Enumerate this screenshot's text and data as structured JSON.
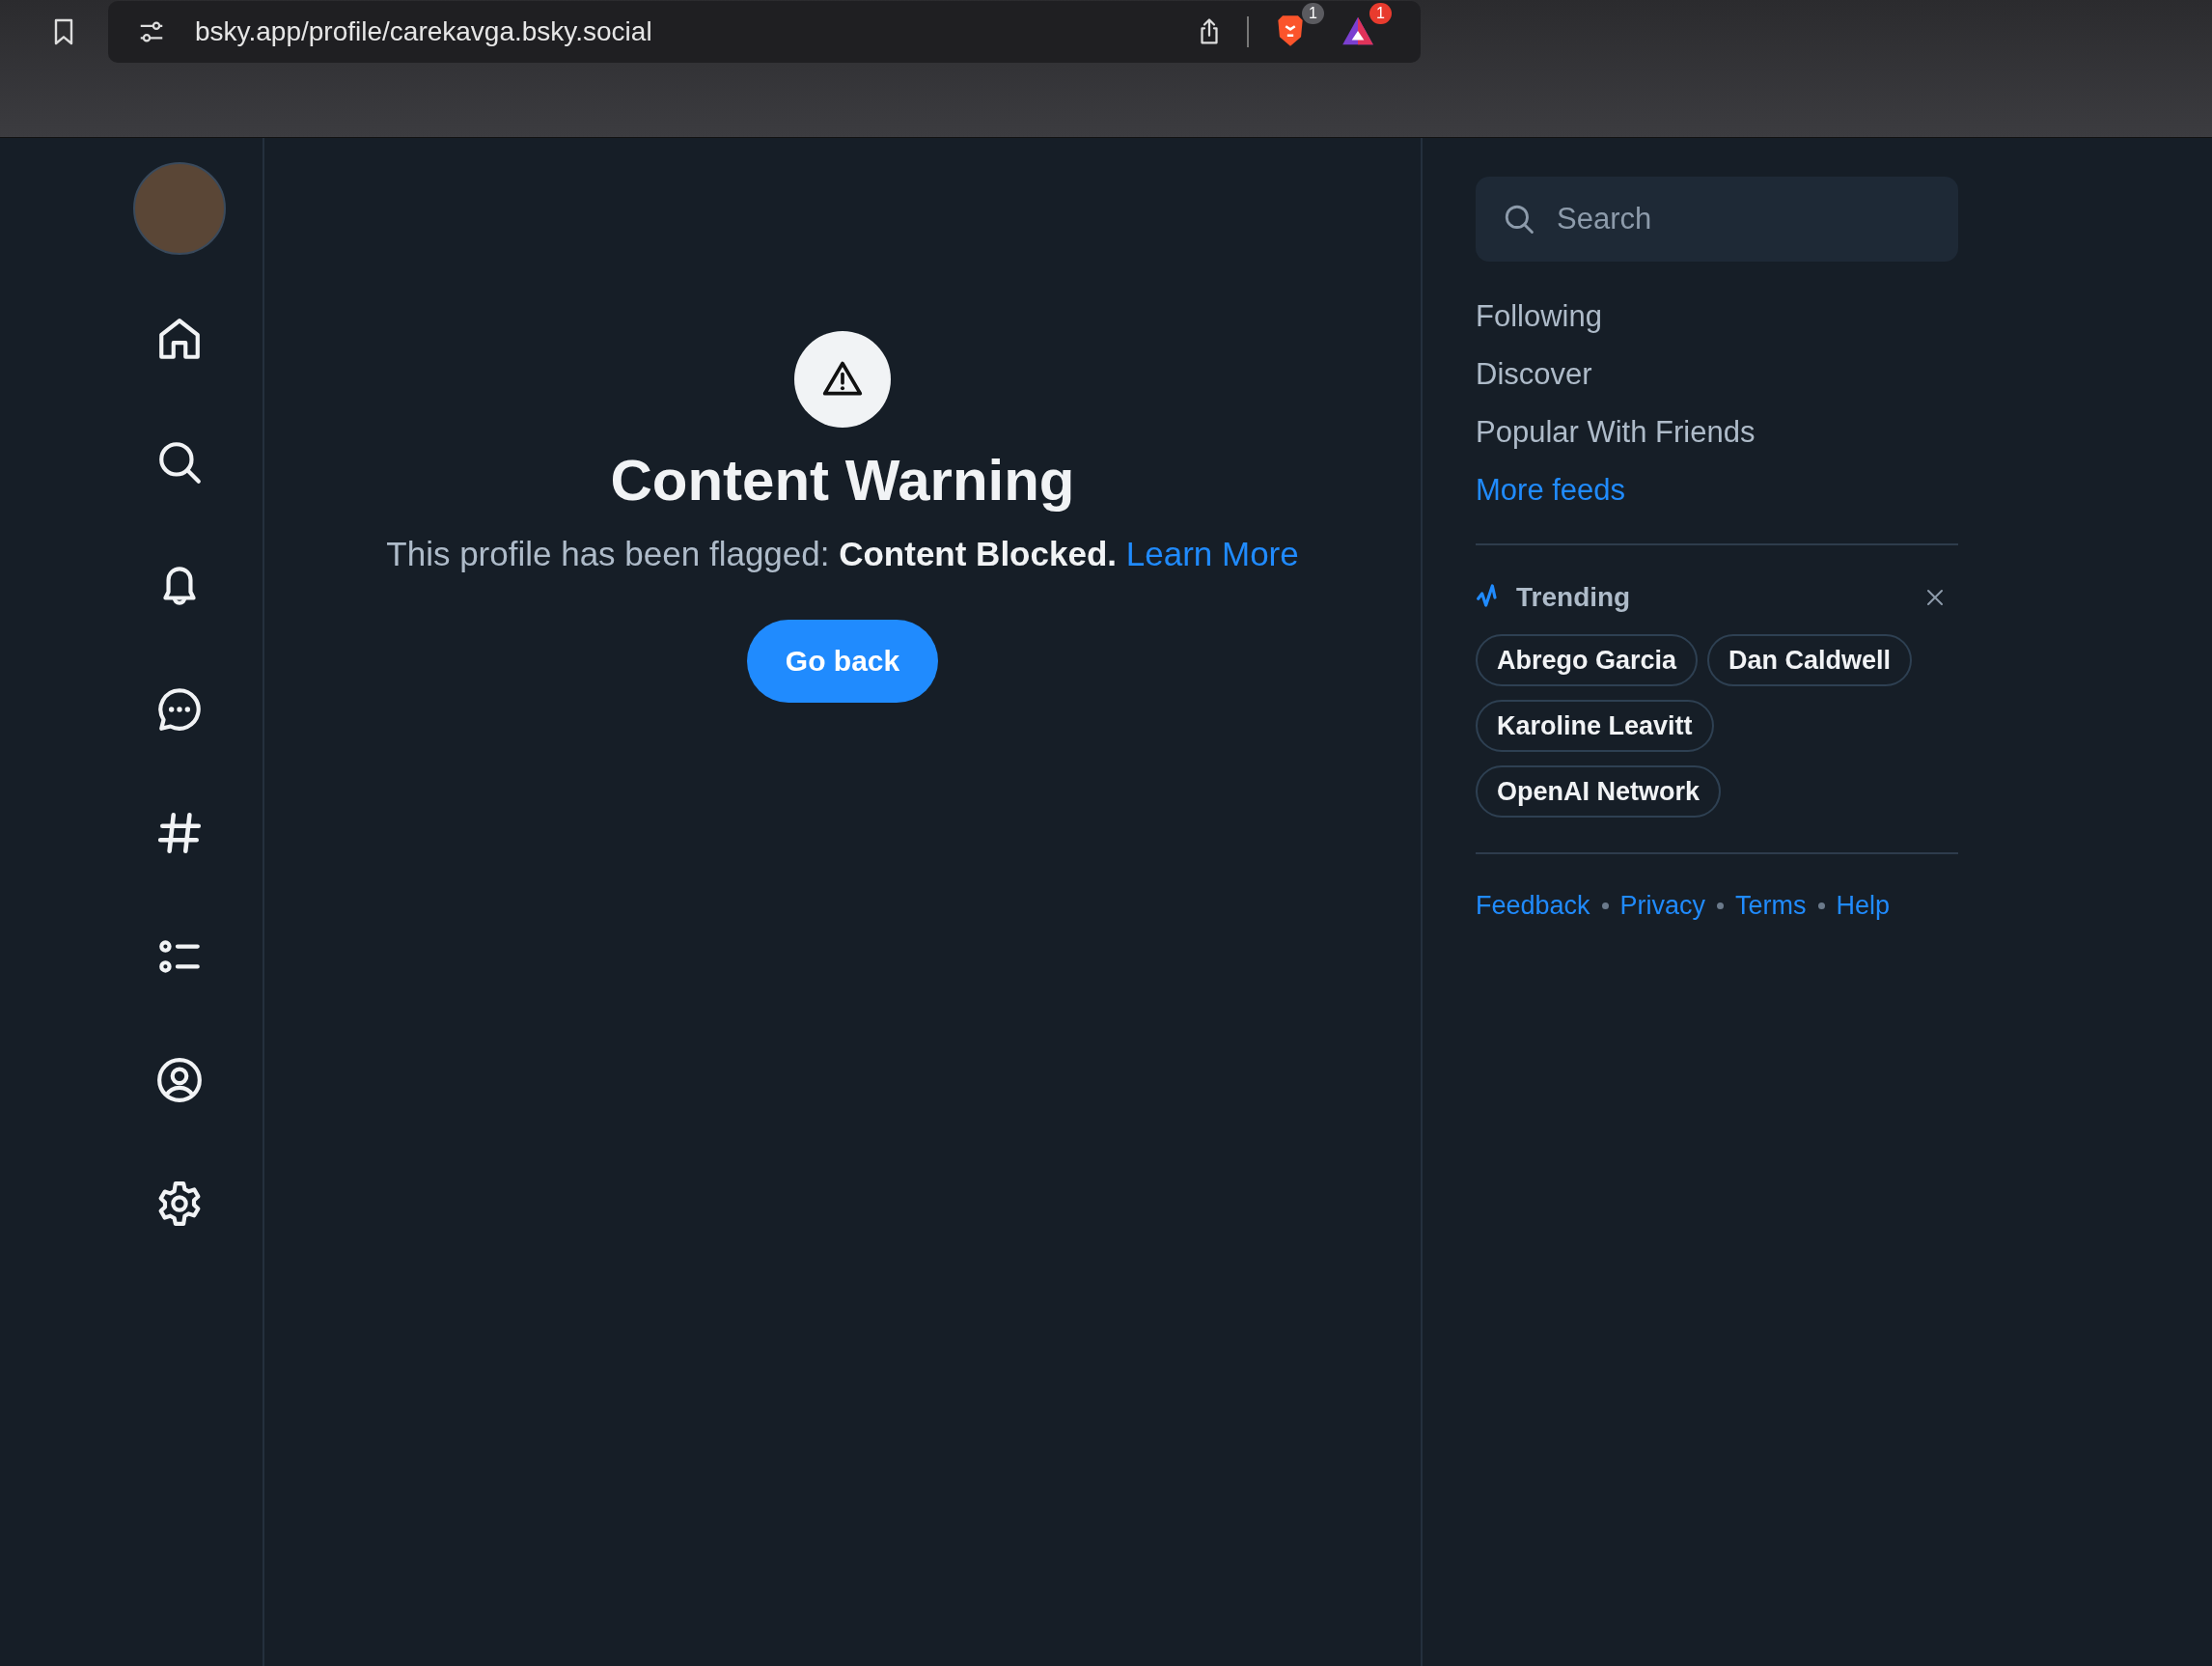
{
  "browser": {
    "url": "bsky.app/profile/carekavga.bsky.social",
    "shield_badge": "1",
    "alert_badge": "1"
  },
  "warning": {
    "title": "Content Warning",
    "message": "This profile has been flagged:  **Content Blocked.**",
    "link": "Learn More",
    "button": "Go back"
  },
  "search": {
    "placeholder": "Search"
  },
  "feeds": [
    {
      "label": "Following",
      "kind": "feed"
    },
    {
      "label": "Discover",
      "kind": "feed"
    },
    {
      "label": "Popular With Friends",
      "kind": "feed"
    },
    {
      "label": "More feeds",
      "kind": "link"
    }
  ],
  "trending": {
    "title": "Trending",
    "topics": [
      "Abrego Garcia",
      "Dan Caldwell",
      "Karoline Leavitt",
      "OpenAI Network"
    ]
  },
  "footer_links": [
    "Feedback",
    "Privacy",
    "Terms",
    "Help"
  ]
}
